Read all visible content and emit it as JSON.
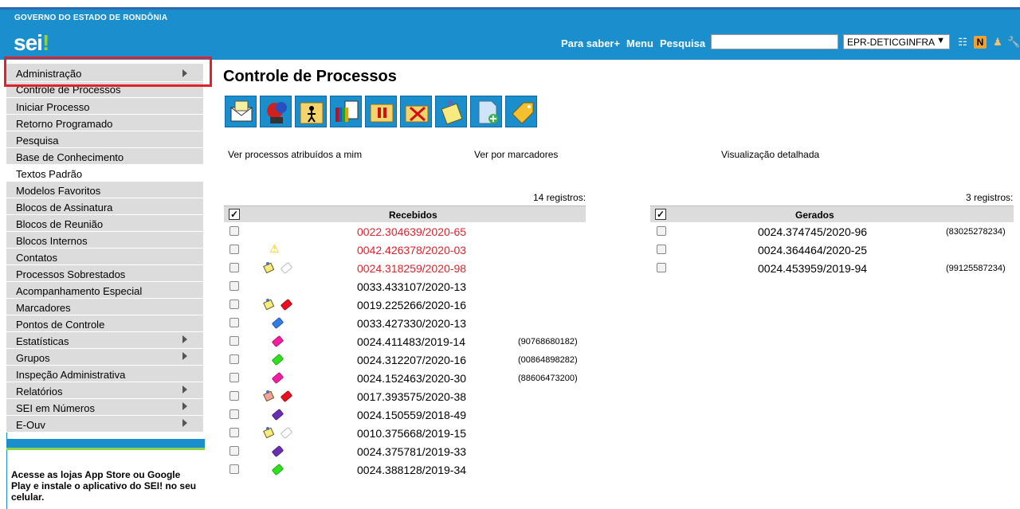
{
  "header": {
    "gov_title": "GOVERNO DO ESTADO DE RONDÔNIA",
    "logo_text": "sei",
    "logo_bang": "!",
    "link_saber": "Para saber+",
    "link_menu": "Menu",
    "link_pesquisa": "Pesquisa",
    "search_value": "",
    "unit_selected": "EPR-DETICGINFRA",
    "icons": [
      "list-icon",
      "n-icon",
      "user-icon",
      "wrench-icon"
    ]
  },
  "sidebar": {
    "items": [
      {
        "label": "Administração",
        "submenu": true
      },
      {
        "label": "Controle de Processos",
        "submenu": false
      },
      {
        "label": "Iniciar Processo",
        "submenu": false
      },
      {
        "label": "Retorno Programado",
        "submenu": false
      },
      {
        "label": "Pesquisa",
        "submenu": false
      },
      {
        "label": "Base de Conhecimento",
        "submenu": false
      },
      {
        "label": "Textos Padrão",
        "submenu": false
      },
      {
        "label": "Modelos Favoritos",
        "submenu": false
      },
      {
        "label": "Blocos de Assinatura",
        "submenu": false
      },
      {
        "label": "Blocos de Reunião",
        "submenu": false
      },
      {
        "label": "Blocos Internos",
        "submenu": false
      },
      {
        "label": "Contatos",
        "submenu": false
      },
      {
        "label": "Processos Sobrestados",
        "submenu": false
      },
      {
        "label": "Acompanhamento Especial",
        "submenu": false
      },
      {
        "label": "Marcadores",
        "submenu": false
      },
      {
        "label": "Pontos de Controle",
        "submenu": false
      },
      {
        "label": "Estatísticas",
        "submenu": true
      },
      {
        "label": "Grupos",
        "submenu": true
      },
      {
        "label": "Inspeção Administrativa",
        "submenu": false
      },
      {
        "label": "Relatórios",
        "submenu": true
      },
      {
        "label": "SEI em Números",
        "submenu": true
      },
      {
        "label": "E-Ouv",
        "submenu": true
      }
    ],
    "app_note": "Acesse as lojas App Store ou Google Play e instale o aplicativo do SEI! no seu celular."
  },
  "main": {
    "title": "Controle de Processos",
    "toolbar_icons": [
      "send-mail-icon",
      "map-icon",
      "assign-person-icon",
      "documents-icon",
      "sobrestar-icon",
      "cancel-icon",
      "note-icon",
      "new-document-icon",
      "tag-icon"
    ],
    "link_atribuidos": "Ver processos atribuídos a mim",
    "link_marcadores": "Ver por marcadores",
    "link_detalhada": "Visualização detalhada",
    "received": {
      "count": "14 registros:",
      "title": "Recebidos",
      "rows": [
        {
          "num": "0022.304639/2020-65",
          "red": true,
          "extra": "",
          "icons": []
        },
        {
          "num": "0042.426378/2020-03",
          "red": true,
          "extra": "",
          "icons": [
            "warning"
          ]
        },
        {
          "num": "0024.318259/2020-98",
          "red": true,
          "extra": "",
          "icons": [
            "note",
            "tag-white"
          ]
        },
        {
          "num": "0033.433107/2020-13",
          "red": false,
          "extra": "",
          "icons": []
        },
        {
          "num": "0019.225266/2020-16",
          "red": false,
          "extra": "",
          "icons": [
            "note",
            "tag-red"
          ]
        },
        {
          "num": "0033.427330/2020-13",
          "red": false,
          "extra": "",
          "icons": [
            "tag-blue"
          ]
        },
        {
          "num": "0024.411483/2019-14",
          "red": false,
          "extra": "(90768680182)",
          "icons": [
            "tag-pink"
          ]
        },
        {
          "num": "0024.312207/2020-16",
          "red": false,
          "extra": "(00864898282)",
          "icons": [
            "tag-green"
          ]
        },
        {
          "num": "0024.152463/2020-30",
          "red": false,
          "extra": "(88606473200)",
          "icons": [
            "tag-pink"
          ]
        },
        {
          "num": "0017.393575/2020-38",
          "red": false,
          "extra": "",
          "icons": [
            "note-red",
            "tag-red"
          ]
        },
        {
          "num": "0024.150559/2018-49",
          "red": false,
          "extra": "",
          "icons": [
            "tag-purple"
          ]
        },
        {
          "num": "0010.375668/2019-15",
          "red": false,
          "extra": "",
          "icons": [
            "note",
            "tag-white"
          ]
        },
        {
          "num": "0024.375781/2019-33",
          "red": false,
          "extra": "",
          "icons": [
            "tag-purple"
          ]
        },
        {
          "num": "0024.388128/2019-34",
          "red": false,
          "extra": "",
          "icons": [
            "tag-green"
          ]
        }
      ]
    },
    "generated": {
      "count": "3 registros:",
      "title": "Gerados",
      "rows": [
        {
          "num": "0024.374745/2020-96",
          "extra": "(83025278234)"
        },
        {
          "num": "0024.364464/2020-25",
          "extra": ""
        },
        {
          "num": "0024.453959/2019-94",
          "extra": "(99125587234)"
        }
      ]
    }
  },
  "colors": {
    "header_blue": "#1b8fcd",
    "accent_green": "#8ed14b",
    "highlight_red": "#e0222c",
    "tag_blue": "#2f7de1",
    "tag_pink": "#f01ea0",
    "tag_green": "#2ee01e",
    "tag_red": "#e81020",
    "tag_purple": "#6a2fb0"
  }
}
